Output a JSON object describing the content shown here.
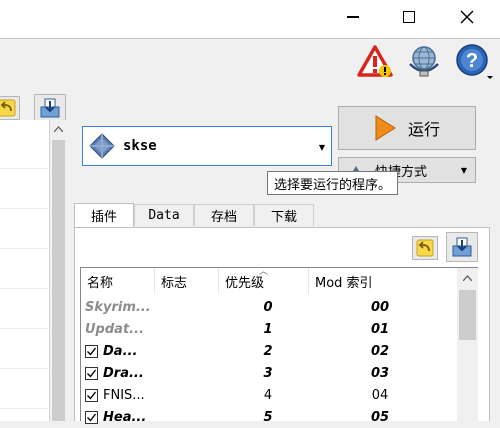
{
  "window": {
    "controls": {
      "minimize": "minimize",
      "maximize": "maximize",
      "close": "close"
    }
  },
  "toolbar": {
    "icons": [
      "warning-icon",
      "network-icon",
      "help-icon"
    ]
  },
  "executable": {
    "selected": "skse",
    "icon": "skse-diamond-icon"
  },
  "run_button": {
    "label": "运行"
  },
  "shortcut_button": {
    "label": "快捷方式"
  },
  "tooltip": {
    "text": "选择要运行的程序。"
  },
  "tabs": [
    {
      "label": "插件",
      "active": true
    },
    {
      "label": "Data",
      "active": false
    },
    {
      "label": "存档",
      "active": false
    },
    {
      "label": "下载",
      "active": false
    }
  ],
  "plugin_table": {
    "columns": [
      "名称",
      "标志",
      "优先级",
      "Mod 索引"
    ],
    "sort_column": "优先级",
    "rows": [
      {
        "name": "Skyrim...",
        "checkbox": false,
        "priority": "0",
        "mod_index": "00",
        "style": "gray-bold-italic"
      },
      {
        "name": "Updat...",
        "checkbox": false,
        "priority": "1",
        "mod_index": "01",
        "style": "gray-bold-italic"
      },
      {
        "name": "Da...",
        "checkbox": true,
        "priority": "2",
        "mod_index": "02",
        "style": "bold-italic"
      },
      {
        "name": "Dra...",
        "checkbox": true,
        "priority": "3",
        "mod_index": "03",
        "style": "bold-italic"
      },
      {
        "name": "FNIS...",
        "checkbox": true,
        "priority": "4",
        "mod_index": "04",
        "style": "normal"
      },
      {
        "name": "Hea...",
        "checkbox": true,
        "priority": "5",
        "mod_index": "05",
        "style": "bold-italic"
      }
    ]
  },
  "colors": {
    "accent_border": "#3c7fd8",
    "warning_red": "#d9261c",
    "warning_yellow": "#f6c500",
    "run_orange": "#f08a1c",
    "help_blue": "#2b63b5"
  }
}
